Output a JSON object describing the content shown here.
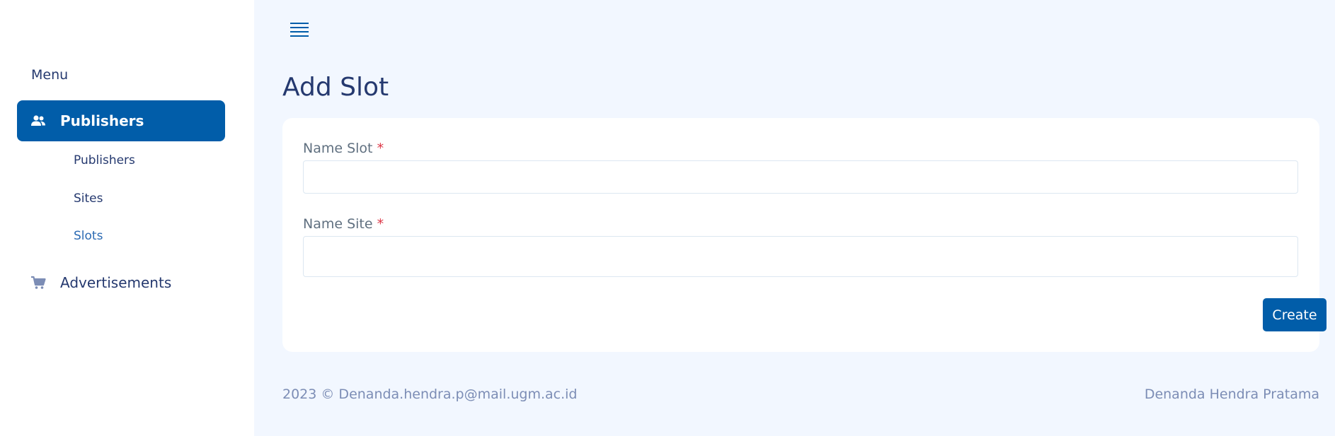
{
  "sidebar": {
    "menu_title": "Menu",
    "items": [
      {
        "label": "Publishers",
        "icon": "users-icon",
        "active": true,
        "children": [
          {
            "label": "Publishers"
          },
          {
            "label": "Sites"
          },
          {
            "label": "Slots",
            "current": true
          }
        ]
      },
      {
        "label": "Advertisements",
        "icon": "cart-icon",
        "active": false
      }
    ]
  },
  "header": {
    "menu_icon": "hamburger-icon"
  },
  "page": {
    "title": "Add Slot"
  },
  "form": {
    "name_slot": {
      "label": "Name Slot",
      "required_mark": "*",
      "value": "",
      "placeholder": ""
    },
    "name_site": {
      "label": "Name Site",
      "required_mark": "*",
      "value": "",
      "placeholder": ""
    },
    "submit_label": "Create"
  },
  "footer": {
    "left": "2023 © Denanda.hendra.p@mail.ugm.ac.id",
    "right": "Denanda Hendra Pratama"
  },
  "colors": {
    "primary": "#015da9",
    "background": "#f2f7ff",
    "text": "#25396f",
    "required": "#dc3545"
  }
}
